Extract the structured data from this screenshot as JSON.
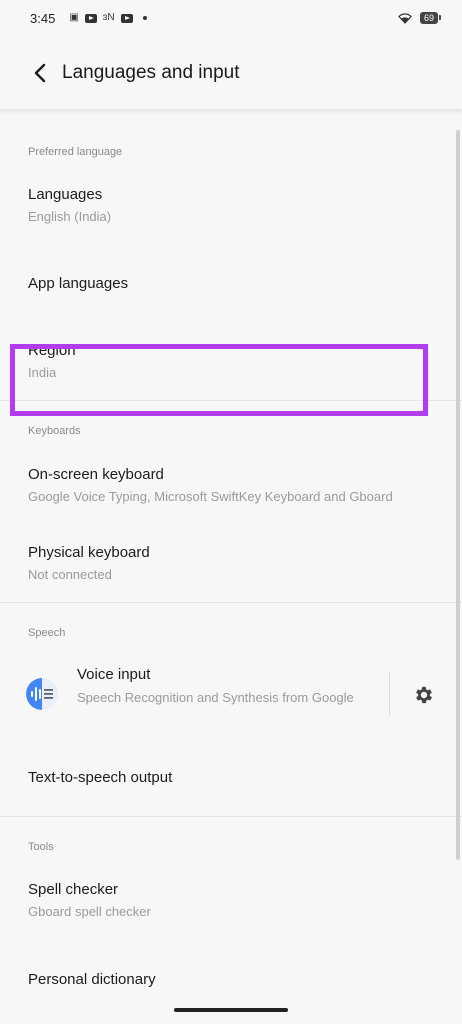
{
  "status_bar": {
    "time": "3:45",
    "battery": "69"
  },
  "header": {
    "title": "Languages and input"
  },
  "sections": {
    "preferred": {
      "header": "Preferred language",
      "languages": {
        "title": "Languages",
        "subtitle": "English (India)"
      },
      "app_languages": {
        "title": "App languages"
      },
      "region": {
        "title": "Region",
        "subtitle": "India"
      }
    },
    "keyboards": {
      "header": "Keyboards",
      "onscreen": {
        "title": "On-screen keyboard",
        "subtitle": "Google Voice Typing, Microsoft SwiftKey Keyboard and Gboard"
      },
      "physical": {
        "title": "Physical keyboard",
        "subtitle": "Not connected"
      }
    },
    "speech": {
      "header": "Speech",
      "voice_input": {
        "title": "Voice input",
        "subtitle": "Speech Recognition and Synthesis from Google"
      },
      "tts": {
        "title": "Text-to-speech output"
      }
    },
    "tools": {
      "header": "Tools",
      "spell": {
        "title": "Spell checker",
        "subtitle": "Gboard spell checker"
      },
      "dictionary": {
        "title": "Personal dictionary"
      }
    }
  },
  "colors": {
    "highlight": "#b33bf0",
    "google_blue": "#4285f4"
  }
}
